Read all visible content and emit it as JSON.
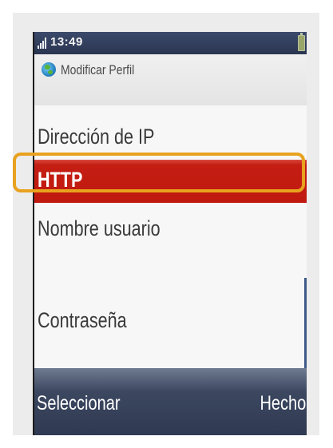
{
  "status_bar": {
    "time": "13:49",
    "signal_icon": "signal-bars-icon",
    "battery_icon": "battery-icon"
  },
  "header": {
    "icon": "globe-icon",
    "title": "Modificar Perfil"
  },
  "menu": {
    "items": [
      {
        "label": "Dirección de IP",
        "selected": false
      },
      {
        "label": "HTTP",
        "selected": true
      },
      {
        "label": "Nombre usuario",
        "selected": false
      },
      {
        "label": "Contraseña",
        "selected": false
      }
    ]
  },
  "softkeys": {
    "left": "Seleccionar",
    "right": "Hecho"
  },
  "colors": {
    "selection": "#c41d12",
    "highlight_outline": "#e8a21f",
    "softkey_bar": "#2f3a52"
  }
}
